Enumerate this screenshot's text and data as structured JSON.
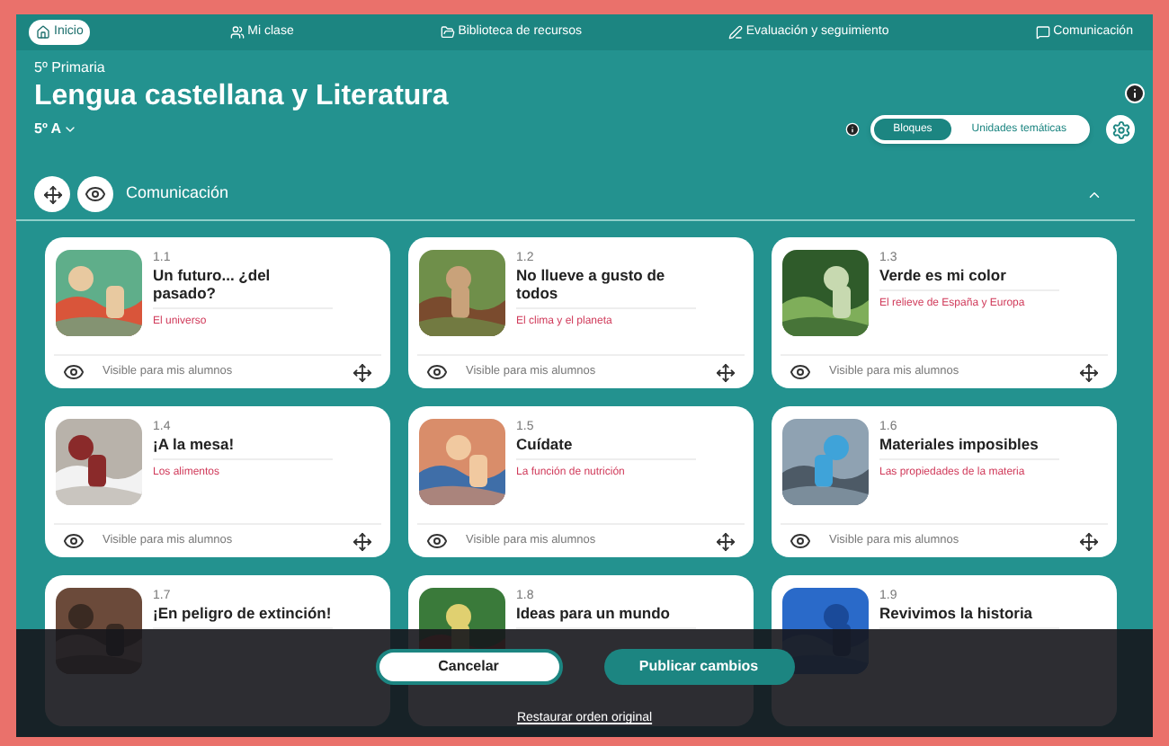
{
  "nav": [
    {
      "label": "Inicio",
      "selected": true
    },
    {
      "label": "Mi clase",
      "selected": false
    },
    {
      "label": "Biblioteca de recursos",
      "selected": false
    },
    {
      "label": "Evaluación y seguimiento",
      "selected": false
    },
    {
      "label": "Comunicación",
      "selected": false
    }
  ],
  "header": {
    "grade": "5º Primaria",
    "title": "Lengua castellana y Literatura",
    "group": "5º A"
  },
  "view_toggle": [
    {
      "label": "Bloques",
      "selected": true
    },
    {
      "label": "Unidades temáticas",
      "selected": false
    }
  ],
  "section": {
    "title": "Comunicación",
    "expanded": true
  },
  "units": [
    {
      "number": "1.1",
      "title": "Un futuro... ¿del pasado?",
      "topic": "El universo",
      "visibility": "Visible para mis alumnos"
    },
    {
      "number": "1.2",
      "title": "No llueve a gusto de todos",
      "topic": "El clima y el planeta",
      "visibility": "Visible para mis alumnos"
    },
    {
      "number": "1.3",
      "title": "Verde es mi color",
      "topic": "El relieve de España y Europa",
      "visibility": "Visible para mis alumnos"
    },
    {
      "number": "1.4",
      "title": "¡A la mesa!",
      "topic": "Los alimentos",
      "visibility": "Visible para mis alumnos"
    },
    {
      "number": "1.5",
      "title": "Cuídate",
      "topic": "La función de nutrición",
      "visibility": "Visible para mis alumnos"
    },
    {
      "number": "1.6",
      "title": "Materiales imposibles",
      "topic": "Las propiedades de la materia",
      "visibility": "Visible para mis alumnos"
    },
    {
      "number": "1.7",
      "title": "¡En peligro de extinción!"
    },
    {
      "number": "1.8",
      "title": "Ideas para un mundo"
    },
    {
      "number": "1.9",
      "title": "Revivimos la historia"
    }
  ],
  "edit_bar": {
    "cancel": "Cancelar",
    "publish": "Publicar cambios",
    "restore": "Restaurar orden original"
  }
}
